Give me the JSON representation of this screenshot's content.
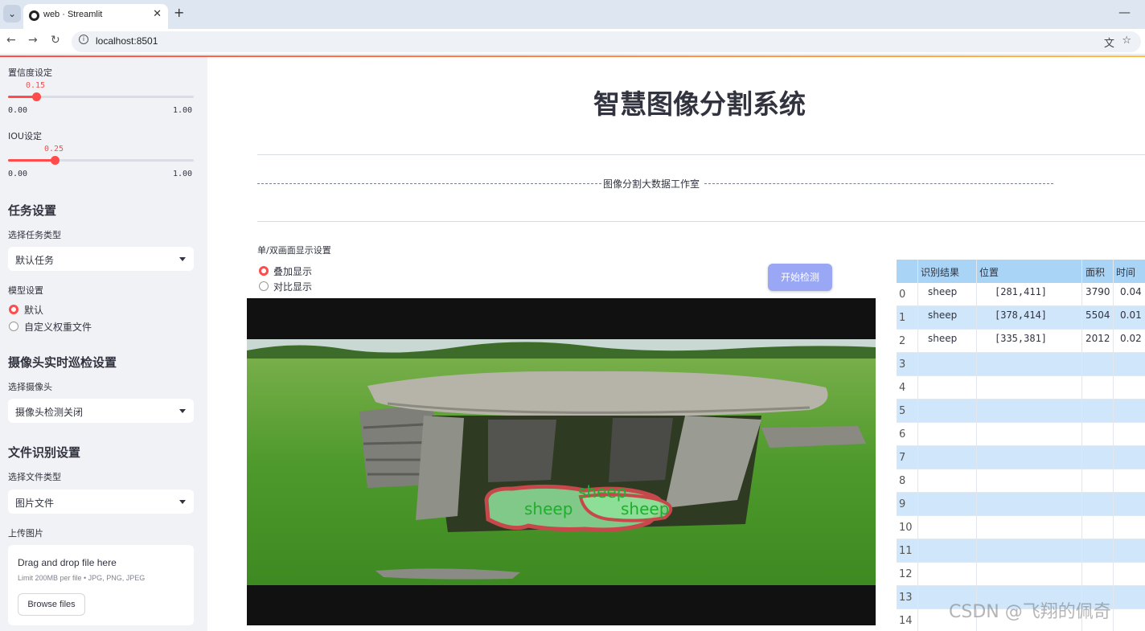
{
  "browser": {
    "tab_title": "web · Streamlit",
    "url": "localhost:8501"
  },
  "sidebar": {
    "confidence": {
      "label": "置信度设定",
      "value": "0.15",
      "min": "0.00",
      "max": "1.00",
      "fraction": 0.15
    },
    "iou": {
      "label": "IOU设定",
      "value": "0.25",
      "min": "0.00",
      "max": "1.00",
      "fraction": 0.25
    },
    "task_heading": "任务设置",
    "task_type_label": "选择任务类型",
    "task_type_value": "默认任务",
    "model_label": "模型设置",
    "model_options": [
      "默认",
      "自定义权重文件"
    ],
    "camera_heading": "摄像头实时巡检设置",
    "camera_label": "选择摄像头",
    "camera_value": "摄像头检测关闭",
    "file_heading": "文件识别设置",
    "file_type_label": "选择文件类型",
    "file_type_value": "图片文件",
    "upload_label": "上传图片",
    "upload_title": "Drag and drop file here",
    "upload_limit": "Limit 200MB per file • JPG, PNG, JPEG",
    "browse_label": "Browse files"
  },
  "main": {
    "title": "智慧图像分割系统",
    "studio": "图像分割大数据工作室",
    "display_label": "单/双画面显示设置",
    "display_options": [
      "叠加显示",
      "对比显示"
    ],
    "start_button": "开始检测",
    "detections": [
      "sheep",
      "sheep",
      "sheep"
    ]
  },
  "table": {
    "headers": [
      "识别结果",
      "位置",
      "面积",
      "时间"
    ],
    "rows": [
      {
        "index": "0",
        "result": "sheep",
        "position": "[281,411]",
        "area": "3790",
        "time": "0.04"
      },
      {
        "index": "1",
        "result": "sheep",
        "position": "[378,414]",
        "area": "5504",
        "time": "0.01"
      },
      {
        "index": "2",
        "result": "sheep",
        "position": "[335,381]",
        "area": "2012",
        "time": "0.02"
      }
    ],
    "empty_indices": [
      "3",
      "4",
      "5",
      "6",
      "7",
      "8",
      "9",
      "10",
      "11",
      "12",
      "13",
      "14"
    ]
  },
  "watermark": "CSDN @飞翔的佩奇",
  "colors": {
    "accent": "#ff4b4b",
    "button": "#9aa7f5",
    "table_header": "#a9d4f5",
    "table_stripe": "#cfe6fb",
    "mask_outline": "#c7484a",
    "mask_fill": "#8fe39a"
  }
}
